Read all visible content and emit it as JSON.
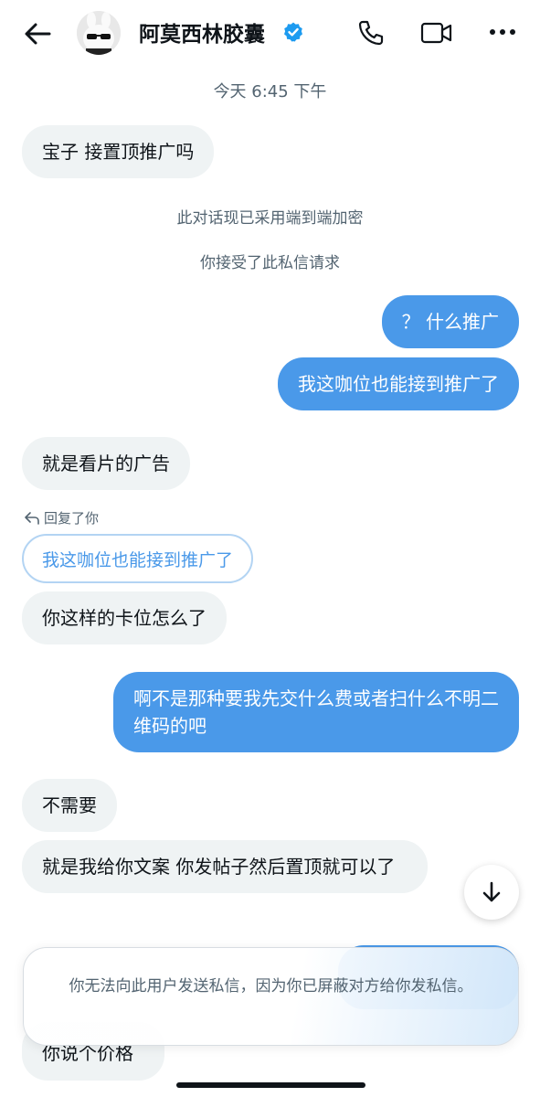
{
  "header": {
    "title": "阿莫西林胶囊",
    "verified": true,
    "icons": [
      "back-arrow-icon",
      "avatar",
      "verified-badge-icon",
      "phone-icon",
      "video-icon",
      "more-icon"
    ]
  },
  "timestamp": "今天 6:45 下午",
  "system_messages": {
    "encrypted": "此对话现已采用端到端加密",
    "accepted": "你接受了此私信请求"
  },
  "messages": {
    "m1": "宝子 接置顶推广吗",
    "m2": "？ 什么推广",
    "m3": "我这咖位也能接到推广了",
    "m4": "就是看片的广告",
    "m5": "你这样的卡位怎么了",
    "m6": "啊不是那种要我先交什么费或者扫什么不明二维码的吧",
    "m7": "不需要",
    "m8": "就是我给你文案 你发帖子然后置顶就可以了",
    "m9": "你说个价格"
  },
  "reply": {
    "label": "回复了你",
    "quoted": "我这咖位也能接到推广了"
  },
  "banner": {
    "text": "你无法向此用户发送私信，因为你已屏蔽对方给你发私信。"
  },
  "colors": {
    "outgoing_bubble": "#4a99e9",
    "incoming_bubble": "#eff3f4",
    "secondary_text": "#536471",
    "verified": "#1d9bf0"
  }
}
